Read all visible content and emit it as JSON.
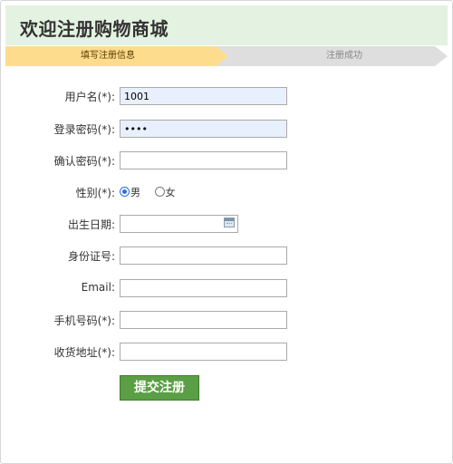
{
  "header": {
    "title": "欢迎注册购物商城"
  },
  "steps": [
    {
      "label": "填写注册信息",
      "active": true
    },
    {
      "label": "注册成功",
      "active": false
    }
  ],
  "form": {
    "username": {
      "label": "用户名(*):",
      "value": "1001"
    },
    "password": {
      "label": "登录密码(*):",
      "value": "••••"
    },
    "confirm_password": {
      "label": "确认密码(*):",
      "value": ""
    },
    "gender": {
      "label": "性别(*):",
      "options": [
        {
          "label": "男",
          "checked": true
        },
        {
          "label": "女",
          "checked": false
        }
      ]
    },
    "birthday": {
      "label": "出生日期:",
      "value": "",
      "icon": "calendar-icon"
    },
    "id_number": {
      "label": "身份证号:",
      "value": ""
    },
    "email": {
      "label": "Email:",
      "value": ""
    },
    "phone": {
      "label": "手机号码(*):",
      "value": ""
    },
    "address": {
      "label": "收货地址(*):",
      "value": ""
    }
  },
  "submit_label": "提交注册",
  "colors": {
    "header_bg": "#e4f2e1",
    "step_active": "#fddc8e",
    "step_inactive": "#dedede",
    "submit_bg": "#5a9e45",
    "autofill_bg": "#e8f0fe"
  }
}
